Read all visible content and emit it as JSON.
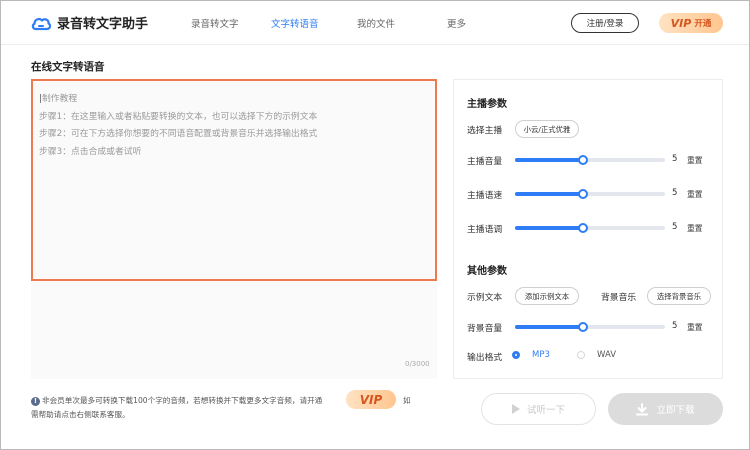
{
  "header": {
    "app_name": "录音转文字助手",
    "tabs": [
      "录音转文字",
      "文字转语音",
      "我的文件",
      "更多"
    ],
    "active_tab": 1,
    "login_label": "注册/登录",
    "vip_word": "VIP",
    "vip_open": "开通"
  },
  "editor": {
    "section_title": "在线文字转语音",
    "caret": "|",
    "lines": [
      "制作教程",
      "步骤1：在这里输入或者粘贴要转换的文本，也可以选择下方的示例文本",
      "步骤2：可在下方选择你想要的不同语音配置或背景音乐并选择输出格式",
      "步骤3：点击合成或者试听"
    ],
    "counter": "0/3000"
  },
  "notice": {
    "line1": "非会员单次最多可转换下载100个字的音频，若想转换并下载更多文字音频，请开通",
    "vip_word": "VIP",
    "ru": "如",
    "line2": "需帮助请点击右侧联系客服。"
  },
  "anchor_params": {
    "title": "主播参数",
    "select_label": "选择主播",
    "select_value": "小云/正式优雅",
    "sliders": [
      {
        "label": "主播音量",
        "value": "5",
        "fraction": 0.45,
        "reset": "重置"
      },
      {
        "label": "主播语速",
        "value": "5",
        "fraction": 0.45,
        "reset": "重置"
      },
      {
        "label": "主播语调",
        "value": "5",
        "fraction": 0.45,
        "reset": "重置"
      }
    ]
  },
  "other_params": {
    "title": "其他参数",
    "example_label": "示例文本",
    "example_button": "添加示例文本",
    "bgm_label": "背景音乐",
    "bgm_button": "选择背景音乐",
    "bg_volume": {
      "label": "背景音量",
      "value": "5",
      "fraction": 0.45,
      "reset": "重置"
    },
    "format_label": "输出格式",
    "formats": [
      {
        "label": "MP3",
        "selected": true
      },
      {
        "label": "WAV",
        "selected": false
      }
    ]
  },
  "actions": {
    "listen_label": "试听一下",
    "download_label": "立即下载"
  },
  "colors": {
    "accent": "#2f7df6",
    "editor_border": "#f07a4f",
    "vip_text": "#d4571f"
  },
  "icons": {
    "logo": "cloud-icon",
    "info": "info-icon",
    "listen": "play-icon",
    "download": "download-icon"
  }
}
